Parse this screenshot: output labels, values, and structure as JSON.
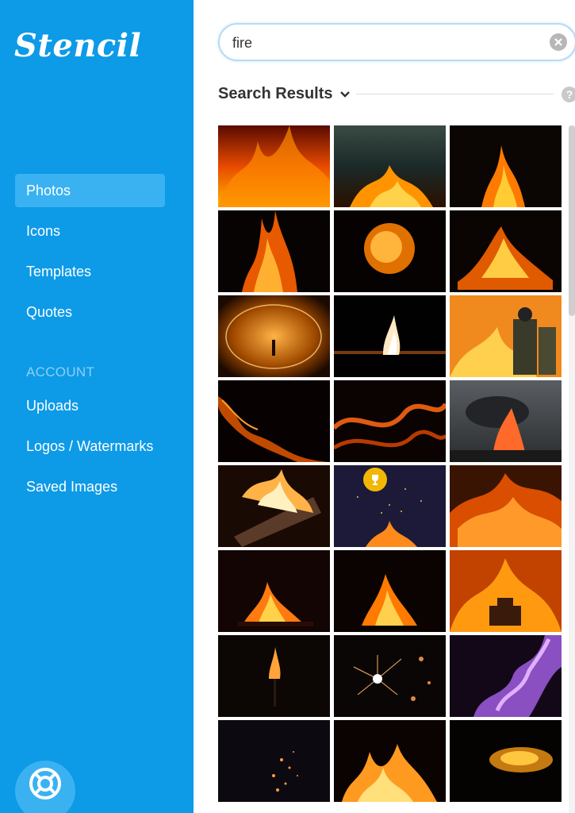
{
  "app": {
    "logo": "Stencil"
  },
  "sidebar": {
    "items": [
      {
        "label": "Photos",
        "active": true
      },
      {
        "label": "Icons"
      },
      {
        "label": "Templates"
      },
      {
        "label": "Quotes"
      }
    ],
    "account_heading": "ACCOUNT",
    "account_items": [
      {
        "label": "Uploads"
      },
      {
        "label": "Logos / Watermarks"
      },
      {
        "label": "Saved Images"
      }
    ],
    "help_icon": "lifebuoy-icon"
  },
  "search": {
    "value": "fire",
    "clear_icon": "clear-icon"
  },
  "results": {
    "title": "Search Results",
    "dropdown_icon": "chevron-down-icon",
    "help_icon": "question-icon"
  },
  "colors": {
    "sidebar": "#0d9ae7",
    "active_item": "#3ab2f2",
    "trophy": "#f2b705"
  },
  "photos": [
    "flames",
    "campfire-sparks",
    "fire-in-dark",
    "flame-column",
    "fire-ball",
    "bonfire",
    "steel-wool-spin",
    "match-flame",
    "firefighters",
    "flame-swirl",
    "flame-swirl",
    "volcano-eruption",
    "burning-logs",
    "sparks-featured",
    "fire-blaze",
    "fireplace",
    "small-fire",
    "fire-structure",
    "candle-flame",
    "sparkler",
    "purple-flame",
    "embers",
    "flames-low",
    "ember-cloud"
  ]
}
